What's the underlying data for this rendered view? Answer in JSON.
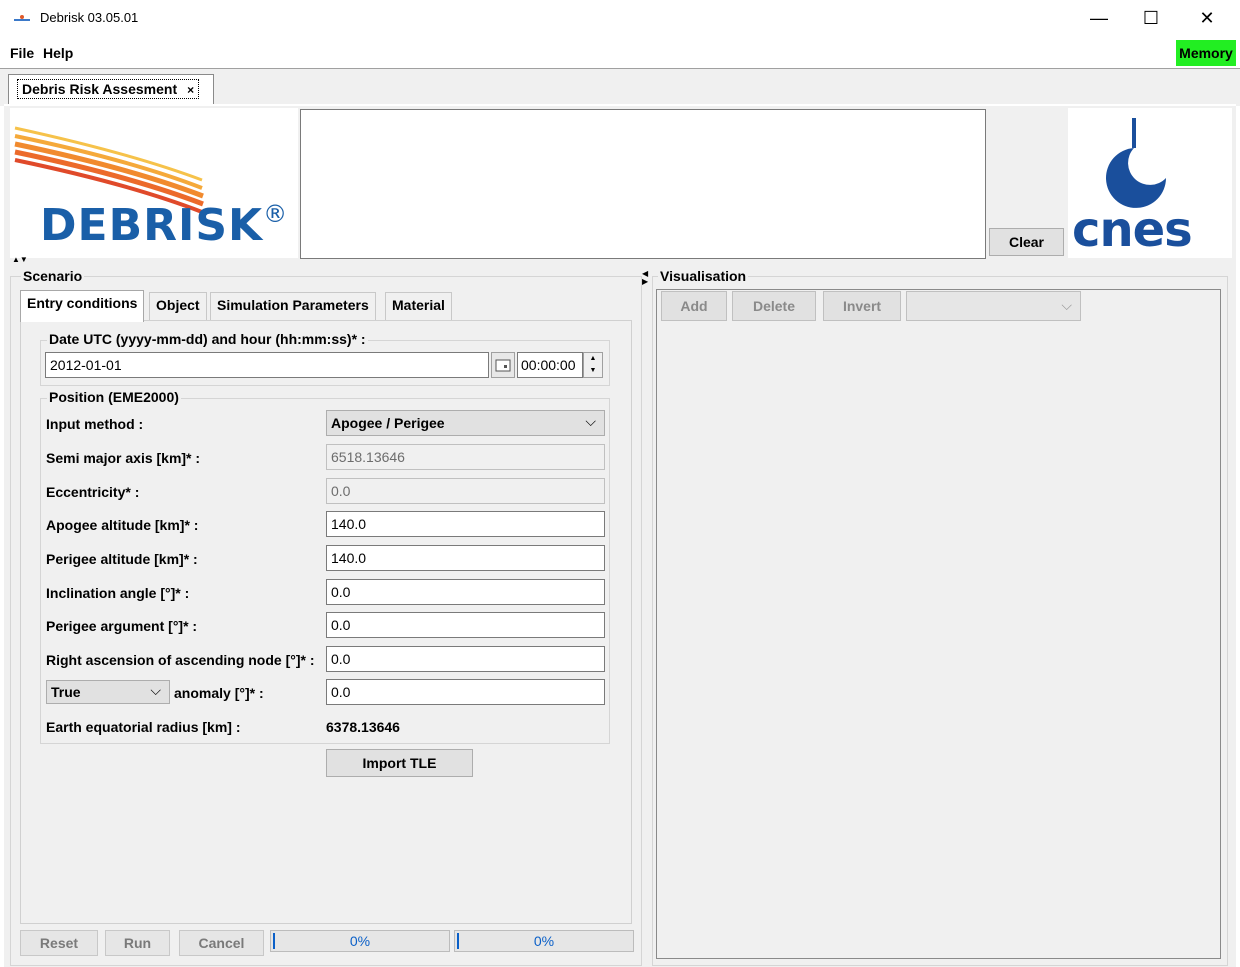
{
  "window": {
    "title": "Debrisk 03.05.01",
    "minimize": "—",
    "maximize": "☐",
    "close": "✕"
  },
  "menu": {
    "file": "File",
    "help": "Help",
    "memory": "Memory"
  },
  "tab": {
    "label": "Debris Risk Assesment",
    "close": "×"
  },
  "header": {
    "logo_text": "DEBRISK",
    "logo_reg": "®",
    "clear": "Clear",
    "agency": "cnes"
  },
  "scenario": {
    "title": "Scenario",
    "tabs": [
      "Entry conditions",
      "Object",
      "Simulation Parameters",
      "Material"
    ],
    "date_title": "Date UTC (yyyy-mm-dd) and hour (hh:mm:ss)* :",
    "date": "2012-01-01",
    "time": "00:00:00",
    "position_title": "Position (EME2000)",
    "input_method_label": "Input method :",
    "input_method": "Apogee / Perigee",
    "rows": [
      {
        "label": "Semi major axis [km]* :",
        "value": "6518.13646"
      },
      {
        "label": "Eccentricity* :",
        "value": "0.0"
      },
      {
        "label": "Apogee altitude [km]* :",
        "value": "140.0"
      },
      {
        "label": "Perigee altitude [km]* :",
        "value": "140.0"
      },
      {
        "label": "Inclination angle [°]* :",
        "value": "0.0"
      },
      {
        "label": "Perigee argument [°]* :",
        "value": "0.0"
      },
      {
        "label": "Right ascension of ascending node [°]* :",
        "value": "0.0"
      }
    ],
    "anomaly_type": "True",
    "anomaly_label": "anomaly [°]* :",
    "anomaly_value": "0.0",
    "earth_radius_label": "Earth equatorial radius [km] :",
    "earth_radius_value": "6378.13646",
    "import_tle": "Import TLE",
    "buttons": {
      "reset": "Reset",
      "run": "Run",
      "cancel": "Cancel"
    },
    "progress1": "0%",
    "progress2": "0%"
  },
  "visualisation": {
    "title": "Visualisation",
    "add": "Add",
    "delete": "Delete",
    "invert": "Invert"
  },
  "colors": {
    "memory": "#22ee22",
    "debrisk_blue": "#1a5fa8",
    "debrisk_orange": "#f08a24",
    "cnes_blue": "#1a4f9c",
    "progress": "#0b60c8"
  }
}
